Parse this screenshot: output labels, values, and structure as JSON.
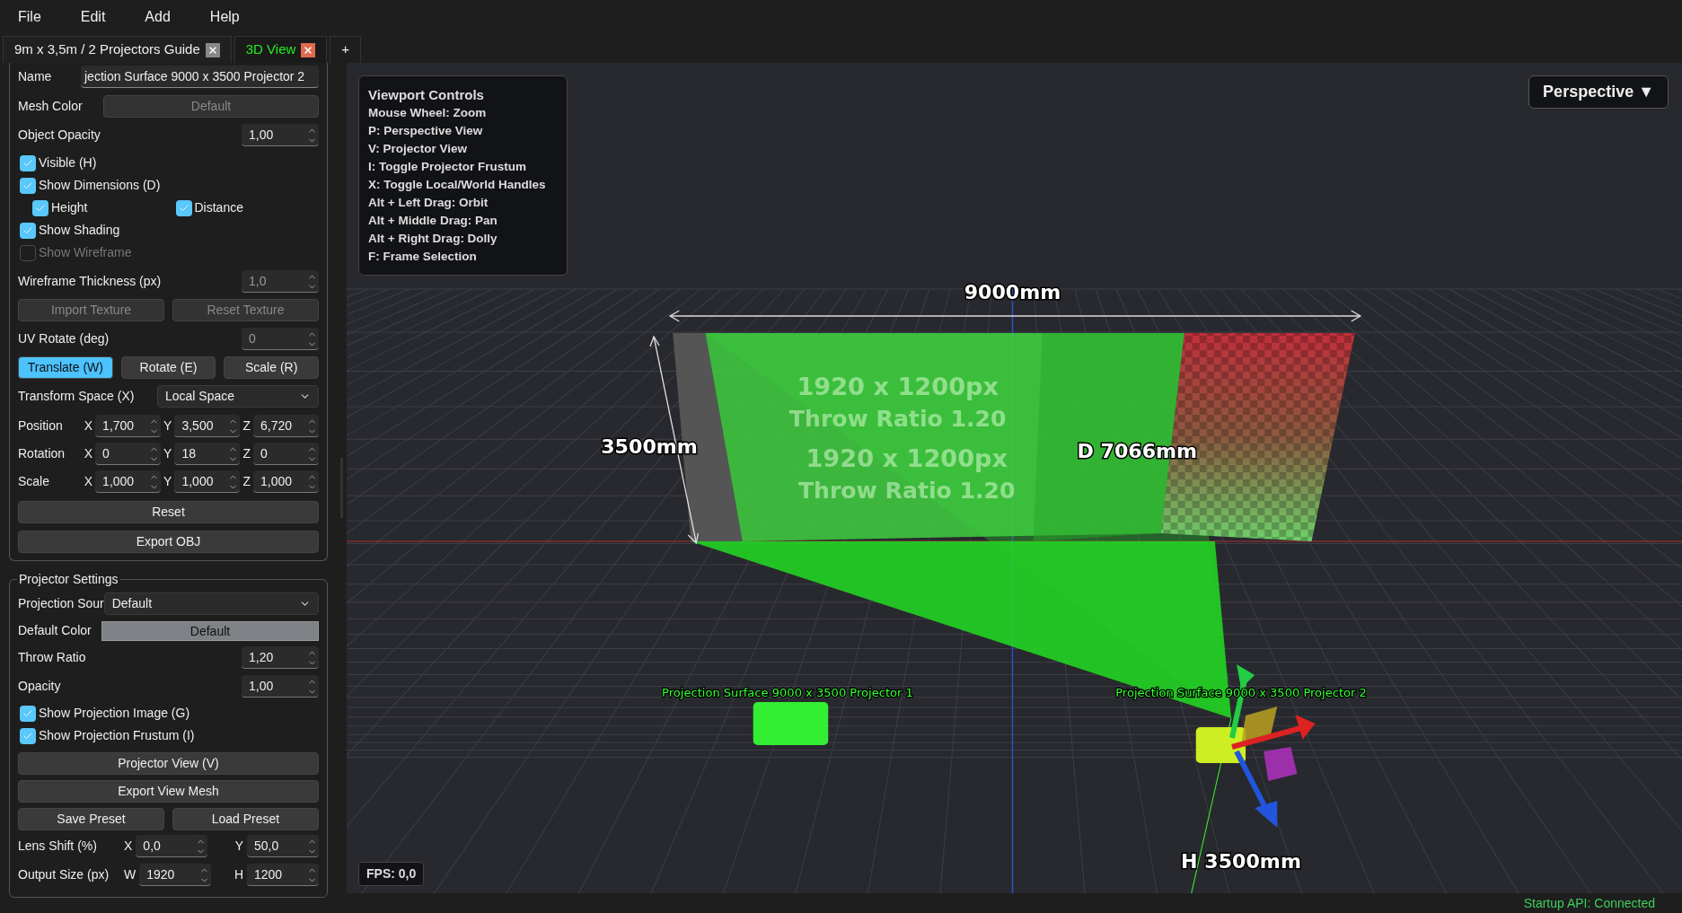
{
  "menu": [
    "File",
    "Edit",
    "Add",
    "Help"
  ],
  "tabs": [
    {
      "label": "9m x 3,5m / 2 Projectors Guide",
      "selected": false
    },
    {
      "label": "3D View",
      "selected": true
    }
  ],
  "add_tab": "+",
  "object_panel": {
    "name": {
      "label": "Name",
      "value": "jection Surface 9000 x 3500 Projector 2"
    },
    "mesh_color": {
      "label": "Mesh Color",
      "button": "Default",
      "disabled": true
    },
    "object_opacity": {
      "label": "Object Opacity",
      "value": "1,00",
      "disabled": false
    },
    "checks": [
      {
        "label": "Visible (H)",
        "checked": true,
        "disabled": false
      },
      {
        "label": "Show Dimensions (D)",
        "checked": true,
        "disabled": false
      }
    ],
    "dimension_checks": [
      {
        "label": "Height",
        "checked": true,
        "disabled": false
      },
      {
        "label": "Distance",
        "checked": true,
        "disabled": false
      }
    ],
    "checks_2": [
      {
        "label": "Show Shading",
        "checked": true,
        "disabled": false
      },
      {
        "label": "Show Wireframe",
        "checked": false,
        "disabled": true
      }
    ],
    "wireframe_thickness": {
      "label": "Wireframe Thickness (px)",
      "value": "1,0",
      "disabled": true
    },
    "texture_buttons": [
      {
        "label": "Import Texture",
        "disabled": true
      },
      {
        "label": "Reset Texture",
        "disabled": true
      }
    ],
    "uv_rotate": {
      "label": "UV Rotate (deg)",
      "value": "0",
      "disabled": true
    },
    "transform_modes": [
      {
        "label": "Translate (W)",
        "selected": true
      },
      {
        "label": "Rotate (E)",
        "selected": false
      },
      {
        "label": "Scale (R)",
        "selected": false
      }
    ],
    "transform_space": {
      "label": "Transform Space (X)",
      "value": "Local Space"
    },
    "vectors": [
      {
        "label": "Position",
        "fields": [
          {
            "axis": "X",
            "value": "1,700"
          },
          {
            "axis": "Y",
            "value": "3,500"
          },
          {
            "axis": "Z",
            "value": "6,720"
          }
        ]
      },
      {
        "label": "Rotation",
        "fields": [
          {
            "axis": "X",
            "value": "0"
          },
          {
            "axis": "Y",
            "value": "18"
          },
          {
            "axis": "Z",
            "value": "0"
          }
        ]
      },
      {
        "label": "Scale",
        "fields": [
          {
            "axis": "X",
            "value": "1,000"
          },
          {
            "axis": "Y",
            "value": "1,000"
          },
          {
            "axis": "Z",
            "value": "1,000"
          }
        ]
      }
    ],
    "buttons": [
      "Reset",
      "Export OBJ"
    ]
  },
  "projector_settings": {
    "title": "Projector Settings",
    "projection_source": {
      "label": "Projection Sour",
      "value": "Default"
    },
    "default_color": {
      "label": "Default Color",
      "button": "Default"
    },
    "spins": [
      {
        "label": "Throw Ratio",
        "value": "1,20"
      },
      {
        "label": "Opacity",
        "value": "1,00"
      }
    ],
    "checks": [
      {
        "label": "Show Projection Image (G)",
        "checked": true,
        "disabled": false
      },
      {
        "label": "Show Projection Frustum (I)",
        "checked": true,
        "disabled": false
      }
    ],
    "buttons": [
      "Projector View (V)",
      "Export View Mesh"
    ],
    "preset_buttons": [
      "Save Preset",
      "Load Preset"
    ],
    "pairs": [
      {
        "label": "Lens Shift (%)",
        "fields": [
          {
            "axis": "X",
            "value": "0,0"
          },
          {
            "axis": "Y",
            "value": "50,0"
          }
        ]
      },
      {
        "label": "Output Size (px)",
        "fields": [
          {
            "axis": "W",
            "value": "1920"
          },
          {
            "axis": "H",
            "value": "1200"
          }
        ]
      }
    ]
  },
  "viewport": {
    "controls": {
      "title": "Viewport Controls",
      "lines": [
        "Mouse Wheel: Zoom",
        "P: Perspective View",
        "V: Projector View",
        "I: Toggle Projector Frustum",
        "X: Toggle Local/World Handles",
        "Alt + Left Drag: Orbit",
        "Alt + Middle Drag: Pan",
        "Alt + Right Drag: Dolly",
        "F: Frame Selection"
      ]
    },
    "view_mode": "Perspective ▼",
    "fps": "FPS: 0,0",
    "labels": [
      {
        "kind": "dimension",
        "text": "9000mm"
      },
      {
        "kind": "dimension",
        "text": "3500mm"
      },
      {
        "kind": "dimension",
        "text": "D 7066mm"
      },
      {
        "kind": "dimension",
        "text": "H 3500mm"
      },
      {
        "kind": "overlay",
        "text": "1920 x 1200px"
      },
      {
        "kind": "overlay",
        "text": "Throw Ratio 1.20"
      },
      {
        "kind": "overlay",
        "text": "1920 x 1200px"
      },
      {
        "kind": "overlay",
        "text": "Throw Ratio 1.20"
      },
      {
        "kind": "object",
        "text": "Projection Surface 9000 x 3500 Projector 1"
      },
      {
        "kind": "object",
        "text": "Projection Surface 9000 x 3500 Projector 2"
      }
    ]
  },
  "status": "Startup API: Connected"
}
